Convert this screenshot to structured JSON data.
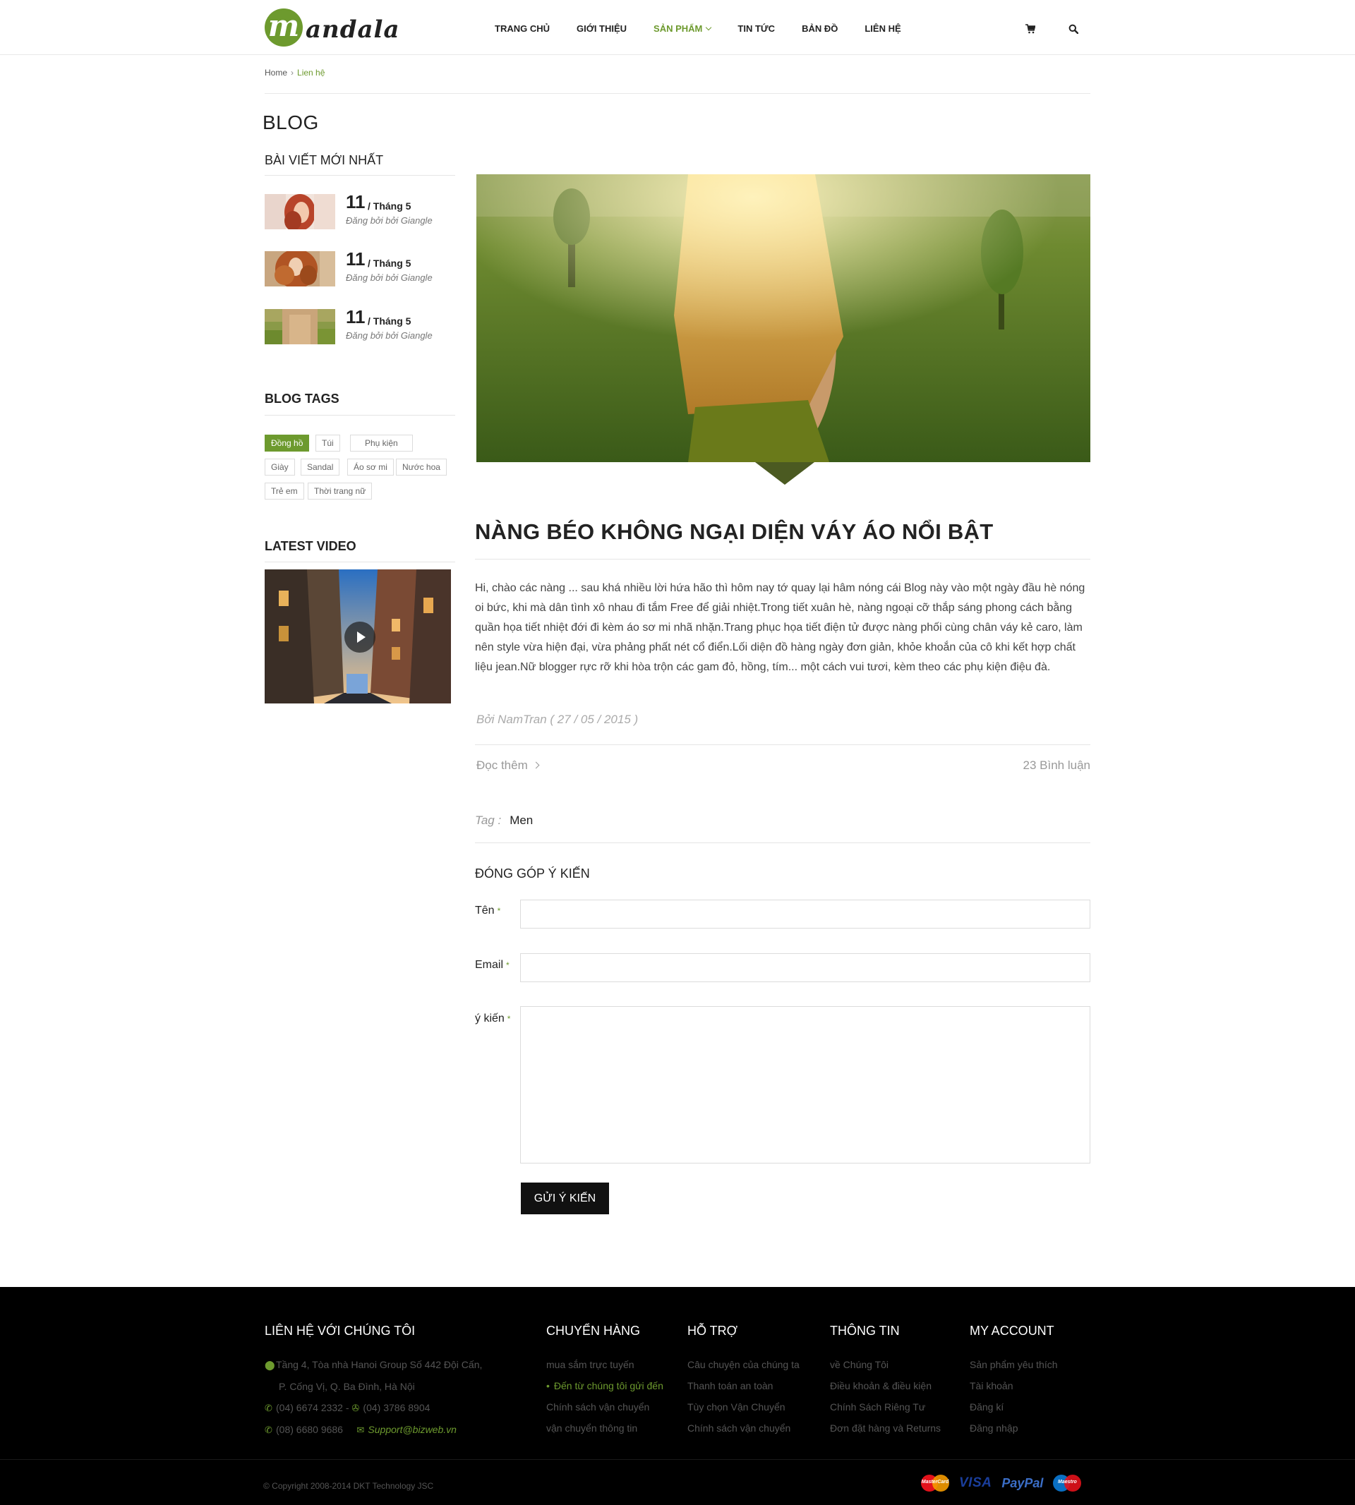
{
  "header": {
    "logo_letter": "m",
    "logo_text": "andala",
    "nav": [
      {
        "label": "TRANG CHỦ"
      },
      {
        "label": "GIỚI THIỆU"
      },
      {
        "label": "SẢN PHẨM"
      },
      {
        "label": "TIN TỨC"
      },
      {
        "label": "BẢN ĐỒ"
      },
      {
        "label": "LIÊN HỆ"
      }
    ],
    "active_nav": "SẢN PHẨM",
    "icons": [
      "cart-icon",
      "search-icon"
    ]
  },
  "breadcrumb": {
    "home": "Home",
    "current": "Lien hệ"
  },
  "page_title": "BLOG",
  "sidebar": {
    "recent_title": "BÀI VIẾT MỚI NHẤT",
    "recent_posts": [
      {
        "day": "11",
        "month": "/ Tháng 5",
        "author": "Đăng bởi bởi Giangle"
      },
      {
        "day": "11",
        "month": "/ Tháng 5",
        "author": "Đăng bởi bởi Giangle"
      },
      {
        "day": "11",
        "month": "/ Tháng 5",
        "author": "Đăng bởi bởi Giangle"
      }
    ],
    "tags_title": "BLOG TAGS",
    "tags": [
      "Đồng hồ",
      "Túi",
      "Phụ kiện",
      "Giày",
      "Sandal",
      "Áo sơ mi",
      "Nước hoa",
      "Trẻ em",
      "Thời trang nữ"
    ],
    "active_tag": "Đồng hồ",
    "video_title": "LATEST VIDEO"
  },
  "article": {
    "title": "NÀNG BÉO KHÔNG NGẠI DIỆN VÁY ÁO NỔI BẬT",
    "body": "Hi, chào các nàng ... sau khá nhiều lời hứa hão thì hôm nay tớ quay lại hâm nóng cái Blog này vào một ngày đầu hè nóng oi bức, khi mà dân tình xô nhau đi tắm Free để giải nhiệt.Trong tiết xuân hè, nàng ngoại cỡ thắp sáng phong cách bằng quần họa tiết nhiệt đới đi kèm áo sơ mi nhã nhặn.Trang phục họa tiết điện tử được nàng phối cùng chân váy kẻ caro, làm nên style vừa hiện đại, vừa phảng phất nét cổ điển.Lối diện đồ hàng ngày đơn giản, khỏe khoắn của cô khi kết hợp chất liệu jean.Nữ blogger rực rỡ khi hòa trộn các gam đỏ, hồng, tím... một cách vui tươi, kèm theo các phụ kiện điệu đà.",
    "meta": "Bởi NamTran ( 27 / 05 / 2015 )",
    "read_more": "Đọc thêm",
    "comments": "23 Bình luận",
    "tag_label": "Tag :",
    "tag_value": "Men"
  },
  "form": {
    "title": "ĐÓNG GÓP Ý KIẾN",
    "name_label": "Tên",
    "email_label": "Email",
    "comment_label": "ý kiến",
    "required_mark": "*",
    "name_value": "",
    "email_value": "",
    "comment_value": "",
    "submit_label": "GỬI Ý KIẾN"
  },
  "footer": {
    "contact_title": "LIÊN HỆ VỚI CHÚNG TÔI",
    "address_1": "Tầng 4, Tòa nhà Hanoi Group  Số 442 Đội Cấn,",
    "address_2": "P. Cống Vị, Q. Ba Đình, Hà Nội",
    "phone_1": "(04) 6674 2332",
    "phone_sep": "-",
    "fax": "(04) 3786 8904",
    "phone_2": "(08) 6680 9686",
    "email": "Support@bizweb.vn",
    "columns": [
      {
        "title": "CHUYỂN HÀNG",
        "links": [
          "mua sắm trực tuyến",
          "Đến từ chúng tôi gửi đến",
          "Chính sách vận chuyển",
          "vận chuyển thông tin"
        ],
        "active": 1
      },
      {
        "title": "HỖ TRỢ",
        "links": [
          "Câu chuyện của chúng ta",
          "Thanh toán an toàn",
          "Tùy chọn Vận Chuyển",
          "Chính sách vận chuyển"
        ],
        "active": -1
      },
      {
        "title": "THÔNG TIN",
        "links": [
          "về Chúng Tôi",
          "Điều khoản & điều kiện",
          "Chính Sách Riêng Tư",
          "Đơn đặt hàng và Returns"
        ],
        "active": -1
      },
      {
        "title": "MY ACCOUNT",
        "links": [
          "Sản phẩm yêu thích",
          "Tài khoản",
          "Đăng kí",
          "Đăng nhập"
        ],
        "active": -1
      }
    ],
    "copyright": "© Copyright 2008-2014 DKT Technology JSC",
    "payments": {
      "mastercard": "MasterCard",
      "visa": "VISA",
      "paypal": "PayPal",
      "maestro": "Maestro"
    }
  },
  "colors": {
    "accent": "#6d9a2e",
    "footer_bg": "#000000",
    "button_bg": "#111111"
  }
}
